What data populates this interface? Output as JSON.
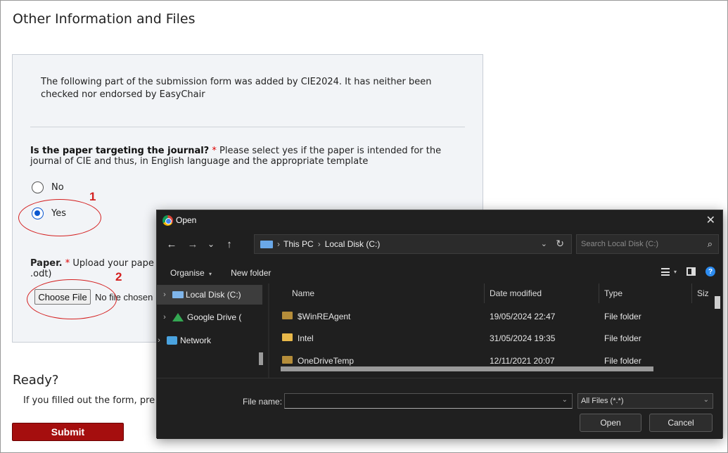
{
  "page": {
    "section_title": "Other Information and Files",
    "note": "The following part of the submission form was added by CIE2024. It has neither been checked nor endorsed by EasyChair",
    "question": {
      "bold": "Is the paper targeting the journal?",
      "asterisk": "*",
      "text": "Please select yes if the paper is intended for the journal of CIE and thus, in English language and the appropriate template"
    },
    "radio_no": "No",
    "radio_yes": "Yes",
    "radio_selected": "Yes",
    "paper": {
      "bold": "Paper.",
      "asterisk": "*",
      "text_line1": "Upload your pape",
      "text_line2": ".odt)"
    },
    "choose_file": "Choose File",
    "no_file": "No file chosen",
    "ready_title": "Ready?",
    "ready_text": "If you filled out the form, pre",
    "submit": "Submit",
    "annotation_1": "1",
    "annotation_2": "2",
    "annotation_color": "#d42020",
    "submit_color": "#a50e0e"
  },
  "dialog": {
    "title": "Open",
    "close": "✕",
    "nav": {
      "back": "←",
      "forward": "→",
      "recent": "⌄",
      "up": "↑"
    },
    "breadcrumb": [
      "This PC",
      "Local Disk (C:)"
    ],
    "breadcrumb_sep": "›",
    "search_placeholder": "Search Local Disk (C:)",
    "organise": "Organise",
    "organise_caret": "▾",
    "new_folder": "New folder",
    "view_caret": "▾",
    "help": "?",
    "sidebar": [
      {
        "label": "Local Disk (C:)",
        "icon": "disk-icon",
        "selected": true
      },
      {
        "label": "Google Drive (",
        "icon": "google-drive-icon",
        "selected": false
      },
      {
        "label": "Network",
        "icon": "network-icon",
        "selected": false
      }
    ],
    "columns": {
      "name": "Name",
      "date": "Date modified",
      "type": "Type",
      "size": "Siz"
    },
    "files": [
      {
        "name": "$WinREAgent",
        "date": "19/05/2024 22:47",
        "type": "File folder"
      },
      {
        "name": "Intel",
        "date": "31/05/2024 19:35",
        "type": "File folder"
      },
      {
        "name": "OneDriveTemp",
        "date": "12/11/2021 20:07",
        "type": "File folder"
      }
    ],
    "file_name_label": "File name:",
    "file_name_value": "",
    "file_type": "All Files (*.*)",
    "open_button": "Open",
    "cancel_button": "Cancel"
  }
}
